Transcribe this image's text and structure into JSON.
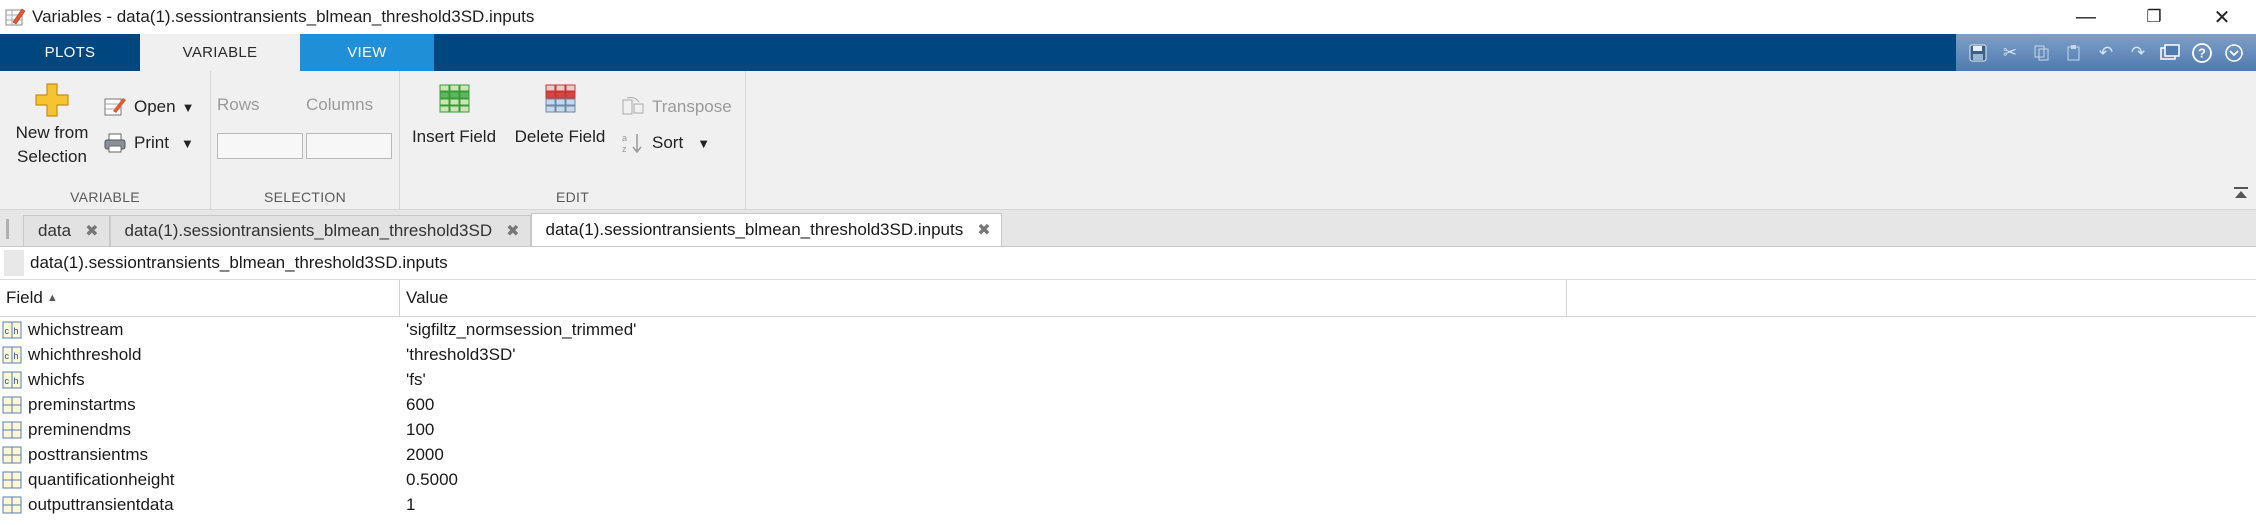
{
  "window": {
    "title": "Variables - data(1).sessiontransients_blmean_threshold3SD.inputs",
    "controls": {
      "minimize": "—",
      "restore": "❐",
      "close": "✕"
    }
  },
  "ribbon_tabs": [
    {
      "label": "PLOTS"
    },
    {
      "label": "VARIABLE"
    },
    {
      "label": "VIEW"
    }
  ],
  "quick_access": [
    {
      "icon": "save-icon"
    },
    {
      "icon": "cut-icon"
    },
    {
      "icon": "copy-icon"
    },
    {
      "icon": "paste-icon"
    },
    {
      "icon": "undo-icon"
    },
    {
      "icon": "redo-icon"
    },
    {
      "icon": "switch-windows-icon"
    },
    {
      "icon": "help-icon"
    },
    {
      "icon": "dropdown-icon"
    }
  ],
  "ribbon": {
    "variable": {
      "new_from_selection": "New from Selection",
      "open": "Open",
      "print": "Print",
      "section_label": "VARIABLE"
    },
    "selection": {
      "rows": "Rows",
      "columns": "Columns",
      "section_label": "SELECTION"
    },
    "edit": {
      "insert_field": "Insert Field",
      "delete_field": "Delete Field",
      "transpose": "Transpose",
      "sort": "Sort",
      "section_label": "EDIT"
    }
  },
  "document_tabs": [
    {
      "label": "data"
    },
    {
      "label": "data(1).sessiontransients_blmean_threshold3SD"
    },
    {
      "label": "data(1).sessiontransients_blmean_threshold3SD.inputs"
    }
  ],
  "breadcrumb": "data(1).sessiontransients_blmean_threshold3SD.inputs",
  "table": {
    "headers": {
      "field": "Field",
      "value": "Value"
    },
    "rows": [
      {
        "field": "whichstream",
        "value": "'sigfiltz_normsession_trimmed'",
        "type": "char"
      },
      {
        "field": "whichthreshold",
        "value": "'threshold3SD'",
        "type": "char"
      },
      {
        "field": "whichfs",
        "value": "'fs'",
        "type": "char"
      },
      {
        "field": "preminstartms",
        "value": "600",
        "type": "numeric"
      },
      {
        "field": "preminendms",
        "value": "100",
        "type": "numeric"
      },
      {
        "field": "posttransientms",
        "value": "2000",
        "type": "numeric"
      },
      {
        "field": "quantificationheight",
        "value": "0.5000",
        "type": "numeric"
      },
      {
        "field": "outputtransientdata",
        "value": "1",
        "type": "numeric"
      }
    ]
  },
  "colors": {
    "tabstrip": "#00467f",
    "view_tab": "#1f8fd8",
    "ribbon_bg": "#f0f0f0"
  }
}
